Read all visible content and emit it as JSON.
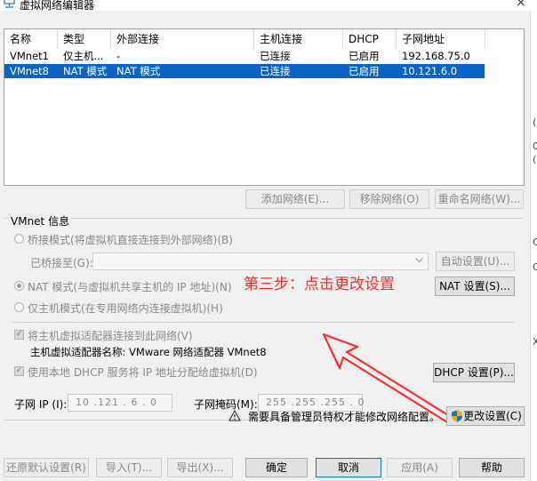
{
  "window": {
    "title": "虚拟网络编辑器",
    "close_glyph": "×"
  },
  "table": {
    "headers": [
      "名称",
      "类型",
      "外部连接",
      "主机连接",
      "DHCP",
      "子网地址"
    ],
    "rows": [
      {
        "name": "VMnet1",
        "type": "仅主机...",
        "external": "-",
        "host": "已连接",
        "dhcp": "已启用",
        "subnet": "192.168.75.0",
        "selected": false
      },
      {
        "name": "VMnet8",
        "type": "NAT 模式",
        "external": "NAT 模式",
        "host": "已连接",
        "dhcp": "已启用",
        "subnet": "10.121.6.0",
        "selected": true
      }
    ]
  },
  "net_buttons": {
    "add": "添加网络(E)...",
    "remove": "移除网络(O)",
    "rename": "重命名网络(W)..."
  },
  "vmnet_info": {
    "title": "VMnet 信息",
    "bridge_mode": "桥接模式(将虚拟机直接连接到外部网络)(B)",
    "bridged_to_label": "已桥接至(G):",
    "auto_settings": "自动设置(U)...",
    "nat_mode": "NAT 模式(与虚拟机共享主机的 IP 地址)(N)",
    "nat_settings": "NAT 设置(S)...",
    "host_only": "仅主机模式(在专用网络内连接虚拟机)(H)",
    "connect_adapter": "将主机虚拟适配器连接到此网络(V)",
    "adapter_name": "主机虚拟适配器名称: VMware 网络适配器 VMnet8",
    "use_dhcp": "使用本地 DHCP 服务将 IP 地址分配给虚拟机(D)",
    "dhcp_settings": "DHCP 设置(P)...",
    "subnet_ip_label": "子网 IP (I):",
    "subnet_ip": "10 .121 . 6 . 0",
    "subnet_mask_label": "子网掩码(M):",
    "subnet_mask": "255 .255 .255 . 0"
  },
  "annotation": "第三步：点击更改设置",
  "admin_notice": "需要具备管理员特权才能修改网络配置。",
  "change_settings": "更改设置(C)",
  "bottom_buttons": {
    "restore": "还原默认设置(R)",
    "import": "导入(T)...",
    "export": "导出(X)...",
    "ok": "确定",
    "cancel": "取消",
    "apply": "应用(A)",
    "help": "帮助"
  },
  "side_strip_chars": [
    "(",
    "0",
    "(",
    "C",
    "C",
    "X"
  ],
  "colors": {
    "selection": "#0a64c8",
    "annotation": "#ff2a2a",
    "shield_blue": "#1f6fd1",
    "shield_gold": "#f0b400"
  }
}
